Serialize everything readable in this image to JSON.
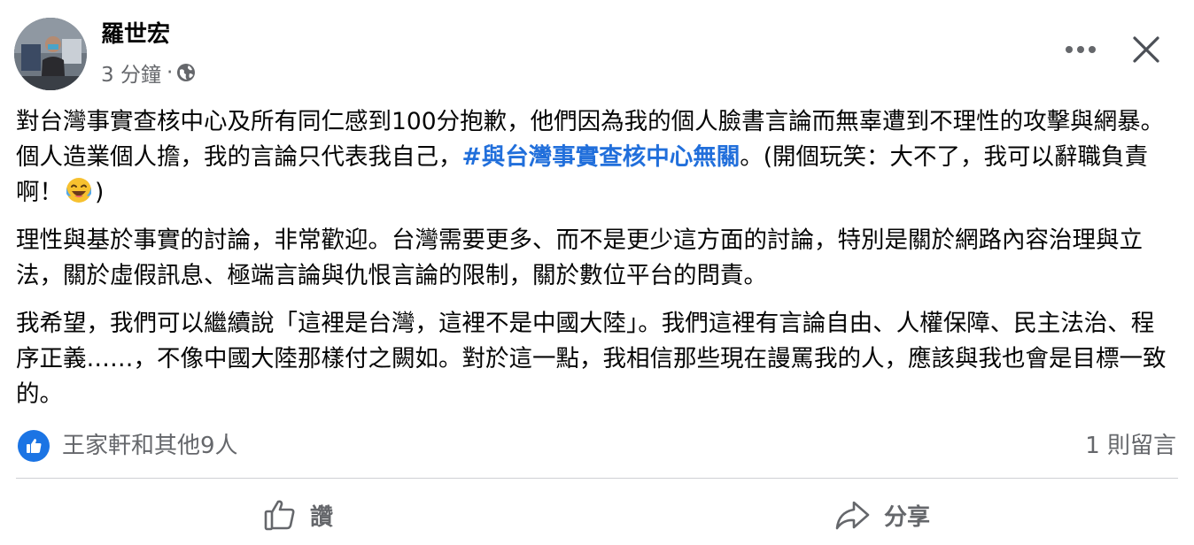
{
  "post": {
    "author": "羅世宏",
    "time": "3 分鐘",
    "separator": "·",
    "privacy_icon": "globe-icon",
    "menu_icon": "more-horizontal-icon",
    "close_icon": "close-icon",
    "body": {
      "p1": {
        "text_before": "對台灣事實查核中心及所有同仁感到100分抱歉，他們因為我的個人臉書言論而無辜遭到不理性的攻擊與網暴。個人造業個人擔，我的言論只代表我自己，",
        "hashtag": "#與台灣事實查核中心無關",
        "text_after": "。(開個玩笑：大不了，我可以辭職負責啊！",
        "emoji": "tears-of-joy-emoji",
        "closing": ")"
      },
      "p2": "理性與基於事實的討論，非常歡迎。台灣需要更多、而不是更少這方面的討論，特別是關於網路內容治理與立法，關於虛假訊息、極端言論與仇恨言論的限制，關於數位平台的問責。",
      "p3": "我希望，我們可以繼續說「這裡是台灣，這裡不是中國大陸」。我們這裡有言論自由、人權保障、民主法治、程序正義……，不像中國大陸那樣付之闕如。對於這一點，我相信那些現在謾罵我的人，應該與我也會是目標一致的。"
    }
  },
  "reactions": {
    "icon": "like-icon",
    "summary": "王家軒和其他9人",
    "comments": "1 則留言"
  },
  "actions": {
    "like_label": "讚",
    "like_icon": "thumbs-up-icon",
    "share_label": "分享",
    "share_icon": "share-icon"
  },
  "colors": {
    "hashtag": "#216fdb",
    "like_blue": "#1b74e4",
    "secondary_text": "#65676b",
    "primary_text": "#050505",
    "divider": "#ced0d4"
  }
}
